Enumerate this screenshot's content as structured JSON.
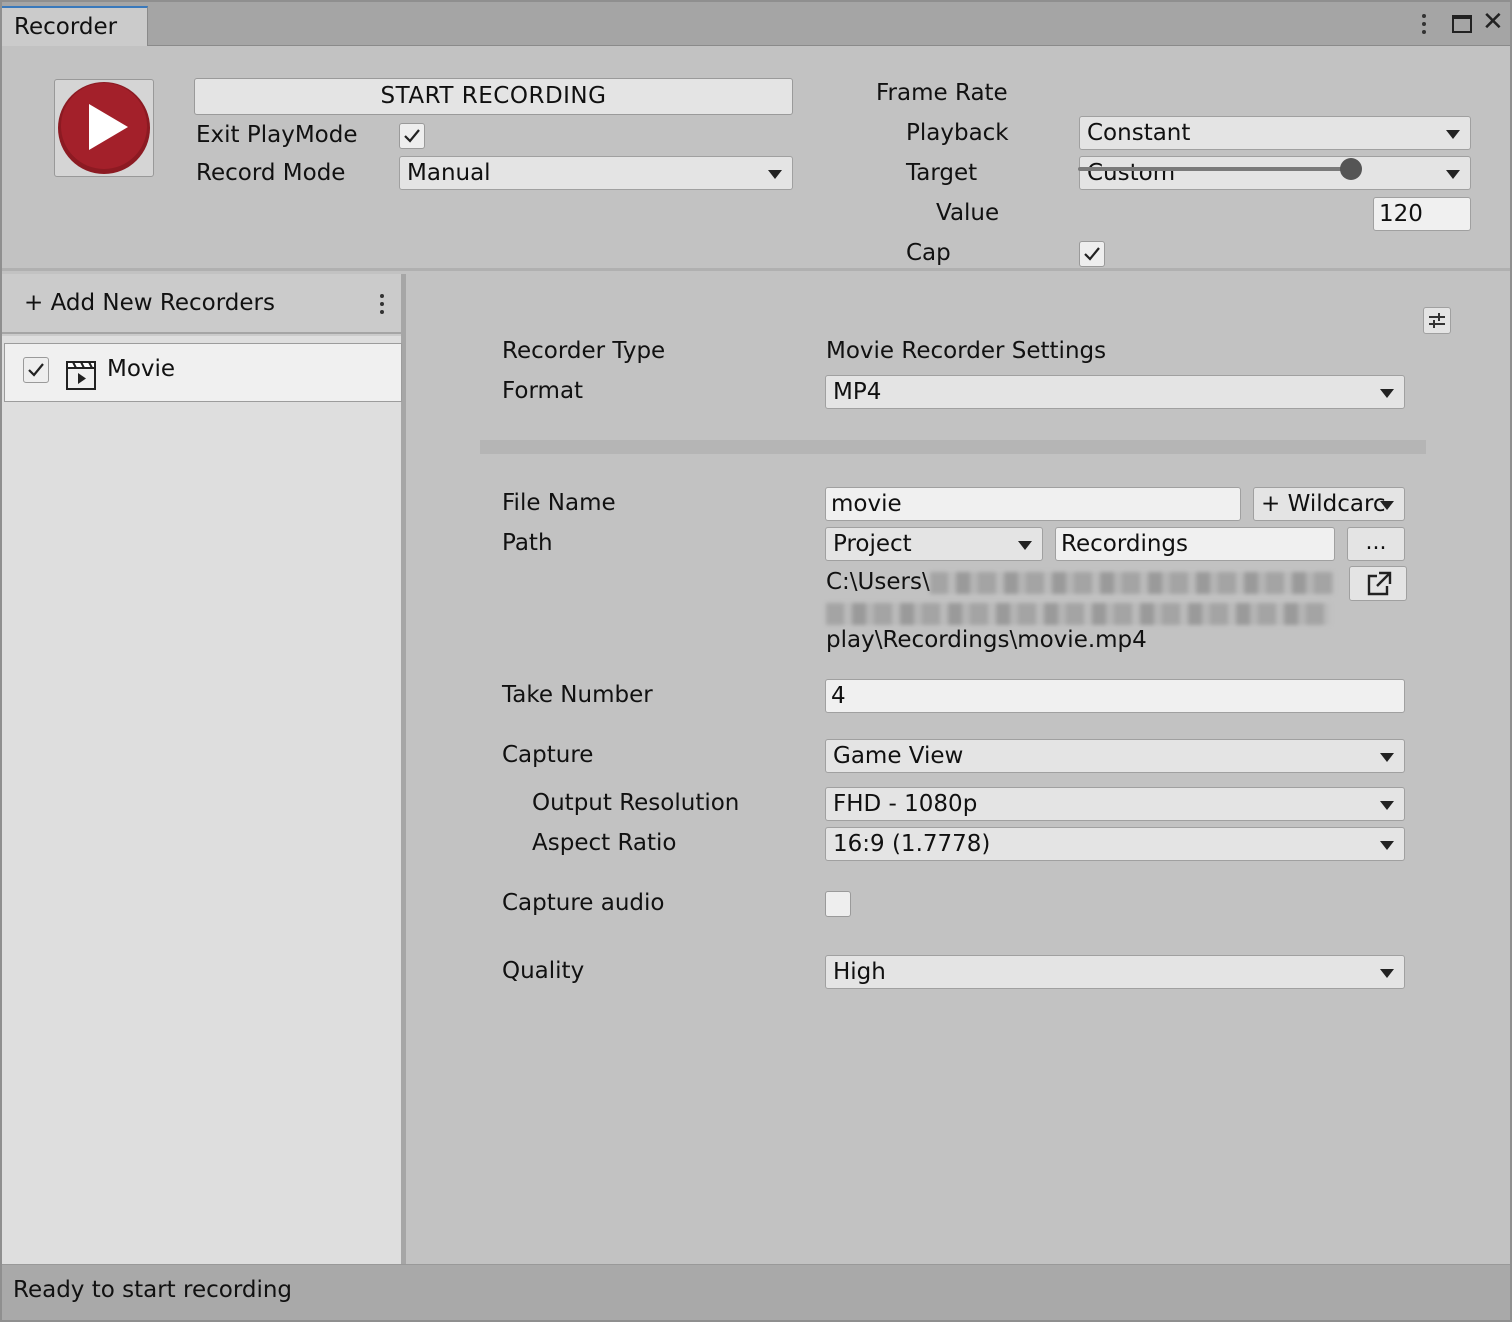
{
  "window": {
    "tab_title": "Recorder",
    "close_glyph": "✕"
  },
  "header": {
    "start_button_label": "START RECORDING",
    "exit_playmode_label": "Exit PlayMode",
    "exit_playmode_checked": true,
    "record_mode_label": "Record Mode",
    "record_mode_value": "Manual"
  },
  "frame_rate": {
    "title": "Frame Rate",
    "playback_label": "Playback",
    "playback_value": "Constant",
    "target_label": "Target",
    "target_value": "Custom",
    "value_label": "Value",
    "value": "120",
    "cap_label": "Cap",
    "cap_checked": true
  },
  "recorders_panel": {
    "add_label": "+ Add New Recorders",
    "items": [
      {
        "label": "Movie",
        "enabled": true,
        "icon": "clapperboard-icon"
      }
    ]
  },
  "settings": {
    "recorder_type_label": "Recorder Type",
    "recorder_type_value": "Movie Recorder Settings",
    "format_label": "Format",
    "format_value": "MP4",
    "file_name_label": "File Name",
    "file_name_value": "movie",
    "wildcards_label": "+ Wildcarc",
    "path_label": "Path",
    "path_root_value": "Project",
    "path_folder_value": "Recordings",
    "browse_label": "...",
    "path_line1_prefix": "C:\\Users\\",
    "path_line3": "play\\Recordings\\movie.mp4",
    "take_number_label": "Take Number",
    "take_number_value": "4",
    "capture_label": "Capture",
    "capture_value": "Game View",
    "output_resolution_label": "Output Resolution",
    "output_resolution_value": "FHD - 1080p",
    "aspect_ratio_label": "Aspect Ratio",
    "aspect_ratio_value": "16:9 (1.7778)",
    "capture_audio_label": "Capture audio",
    "capture_audio_checked": false,
    "quality_label": "Quality",
    "quality_value": "High"
  },
  "status": {
    "text": "Ready to start recording"
  },
  "colors": {
    "record_button_red": "#a3202a",
    "tab_accent": "#3a79bb"
  }
}
